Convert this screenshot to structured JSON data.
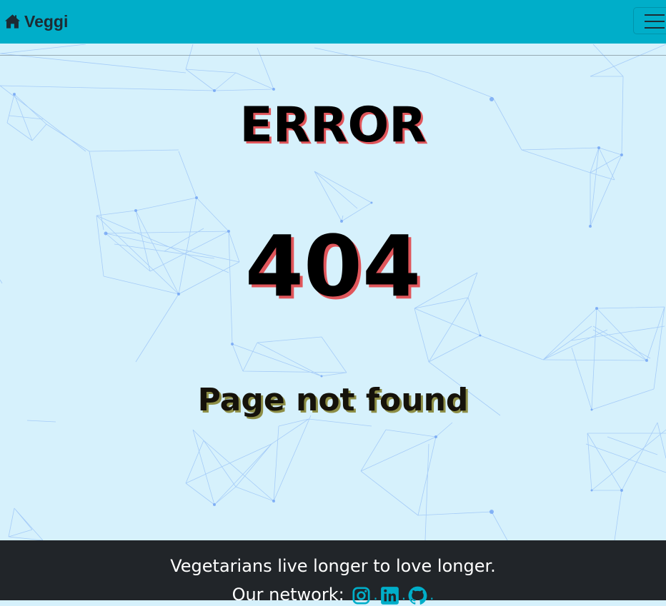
{
  "navbar": {
    "brand_label": "Veggi",
    "brand_icon": "home-icon",
    "toggler_icon": "hamburger-menu-icon",
    "background_color": "#00aec9"
  },
  "error_page": {
    "title": "ERROR",
    "code": "404",
    "message": "Page not found",
    "background_color": "#d6f1fc",
    "network_color": "#6b9ff3"
  },
  "footer": {
    "tagline": "Vegetarians live longer to love longer.",
    "network_label": "Our network:",
    "separator": ".",
    "social_links": [
      {
        "name": "instagram",
        "icon": "instagram-icon"
      },
      {
        "name": "linkedin",
        "icon": "linkedin-icon"
      },
      {
        "name": "github",
        "icon": "github-icon"
      }
    ],
    "background_color": "#212529",
    "accent_color": "#00aec9"
  }
}
